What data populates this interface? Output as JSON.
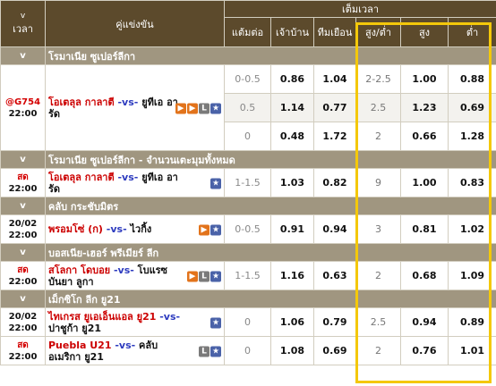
{
  "header": {
    "chevron": "v",
    "time_label": "เวลา",
    "match_label": "คู่แข่งขัน",
    "fulltime_label": "เต็มเวลา",
    "handicap_label": "แต้มต่อ",
    "home_label": "เจ้าบ้าน",
    "away_label": "ทีมเยือน",
    "ou_label": "สูง/ต่ำ",
    "over_label": "สูง",
    "under_label": "ต่ำ"
  },
  "leagues": [
    {
      "name": "โรมาเนีย ซูเปอร์ลีกา",
      "events": [
        {
          "time_top": "@G754",
          "time_bottom": "22:00",
          "home": "โอเตลุล กาลาตี",
          "vs": "-vs-",
          "away": "ยูทีเอ อารัด",
          "icons": [
            "tv",
            "tv",
            "L",
            "star"
          ],
          "odds": [
            {
              "hcap": "0-0.5",
              "home": "0.86",
              "away": "1.04",
              "ou": "2-2.5",
              "over": "1.00",
              "under": "0.88"
            },
            {
              "hcap": "0.5",
              "home": "1.14",
              "away": "0.77",
              "ou": "2.5",
              "over": "1.23",
              "under": "0.69"
            },
            {
              "hcap": "0",
              "home": "0.48",
              "away": "1.72",
              "ou": "2",
              "over": "0.66",
              "under": "1.28"
            }
          ]
        }
      ]
    },
    {
      "name": "โรมาเนีย ซูเปอร์ลีกา - จำนวนเตะมุมทั้งหมด",
      "events": [
        {
          "time_top": "สด",
          "time_bottom": "22:00",
          "home": "โอเตลุล กาลาตี",
          "vs": "-vs-",
          "away": "ยูทีเอ อารัด",
          "icons": [
            "star"
          ],
          "odds": [
            {
              "hcap": "1-1.5",
              "home": "1.03",
              "away": "0.82",
              "ou": "9",
              "over": "1.00",
              "under": "0.83"
            }
          ]
        }
      ]
    },
    {
      "name": "คลับ กระชับมิตร",
      "events": [
        {
          "time_top": "20/02",
          "time_bottom": "22:00",
          "home": "พรอมโซ่ (ก)",
          "vs": "-vs-",
          "away": "ไวกิ้ง",
          "icons": [
            "tv",
            "star"
          ],
          "odds": [
            {
              "hcap": "0-0.5",
              "home": "0.91",
              "away": "0.94",
              "ou": "3",
              "over": "0.81",
              "under": "1.02"
            }
          ]
        }
      ]
    },
    {
      "name": "บอสเนีย-เฮอร์ พรีเมียร์ ลีก",
      "events": [
        {
          "time_top": "สด",
          "time_bottom": "22:00",
          "home": "สโลกา โดบอย",
          "vs": "-vs-",
          "away": "โบแรซ บันยา ลูกา",
          "icons": [
            "tv",
            "L",
            "star"
          ],
          "odds": [
            {
              "hcap": "1-1.5",
              "home": "1.16",
              "away": "0.63",
              "ou": "2",
              "over": "0.68",
              "under": "1.09"
            }
          ]
        }
      ]
    },
    {
      "name": "เม็กซิโก ลีก ยู21",
      "events": [
        {
          "time_top": "20/02",
          "time_bottom": "22:00",
          "home": "ไทเกรส ยูเอเอ็นแอล ยู21",
          "vs": "-vs-",
          "away": "ปาชูก้า ยู21",
          "icons": [
            "star"
          ],
          "odds": [
            {
              "hcap": "0",
              "home": "1.06",
              "away": "0.79",
              "ou": "2.5",
              "over": "0.94",
              "under": "0.89"
            }
          ]
        },
        {
          "time_top": "สด",
          "time_bottom": "22:00",
          "home": "Puebla U21",
          "vs": "-vs-",
          "away": "คลับ อเมริกา ยู21",
          "icons": [
            "L",
            "star"
          ],
          "odds": [
            {
              "hcap": "0",
              "home": "1.08",
              "away": "0.69",
              "ou": "2",
              "over": "0.76",
              "under": "1.01"
            }
          ]
        }
      ]
    }
  ],
  "colors": {
    "header": "#5c4a2c",
    "league_bar": "#a09680",
    "highlight": "#f4c80a",
    "live_red": "#d40000",
    "vs_blue": "#2d3bbf"
  }
}
